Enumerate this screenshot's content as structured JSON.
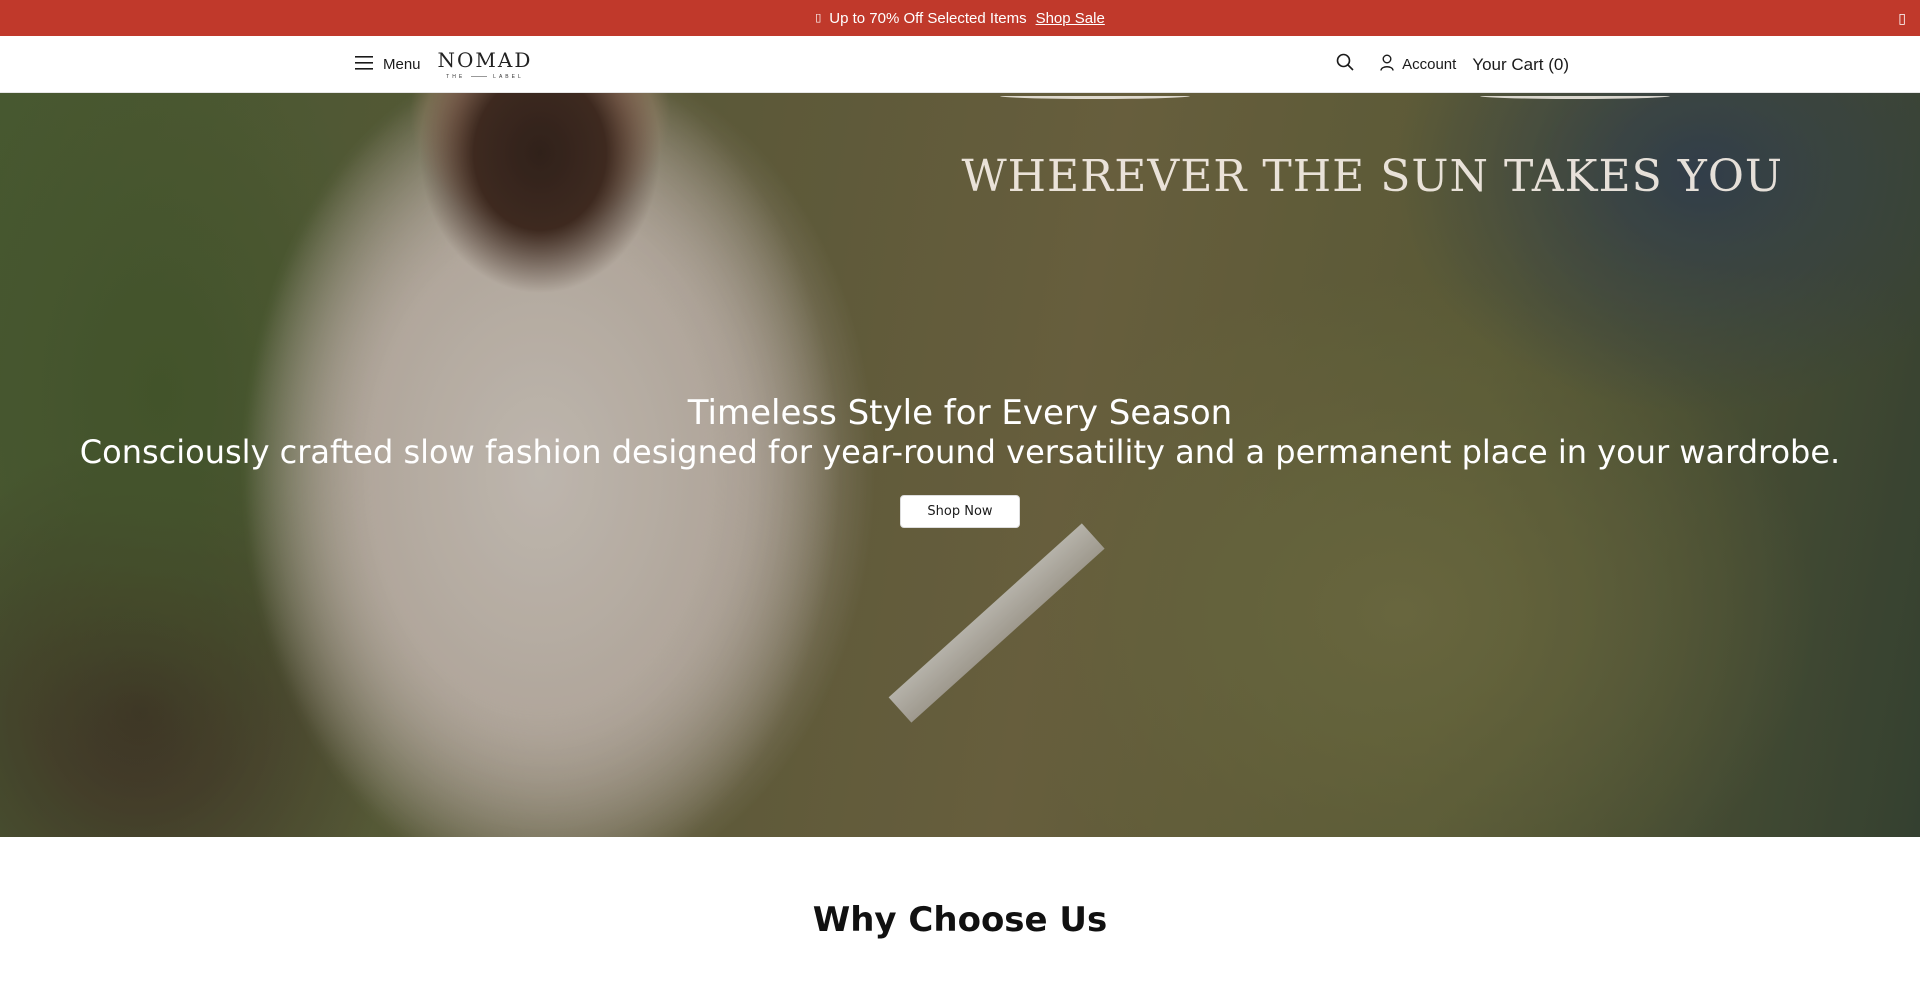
{
  "announcement": {
    "tag_icon": "tag-icon",
    "text": "Up to 70% Off Selected Items",
    "link_label": "Shop Sale",
    "close_icon": "close-icon",
    "background_color": "#c0392b"
  },
  "header": {
    "menu_label": "Menu",
    "logo": {
      "word": "NOMAD",
      "sub_left": "THE",
      "sub_right": "LABEL"
    },
    "account_label": "Account",
    "cart_label": "Your Cart (0)"
  },
  "hero": {
    "tagline": "WHEREVER THE SUN TAKES YOU",
    "title": "Timeless Style for Every Season",
    "subtitle": "Consciously crafted slow fashion designed for year-round versatility and a permanent place in your wardrobe.",
    "cta_label": "Shop Now"
  },
  "why_section": {
    "heading": "Why Choose Us"
  }
}
